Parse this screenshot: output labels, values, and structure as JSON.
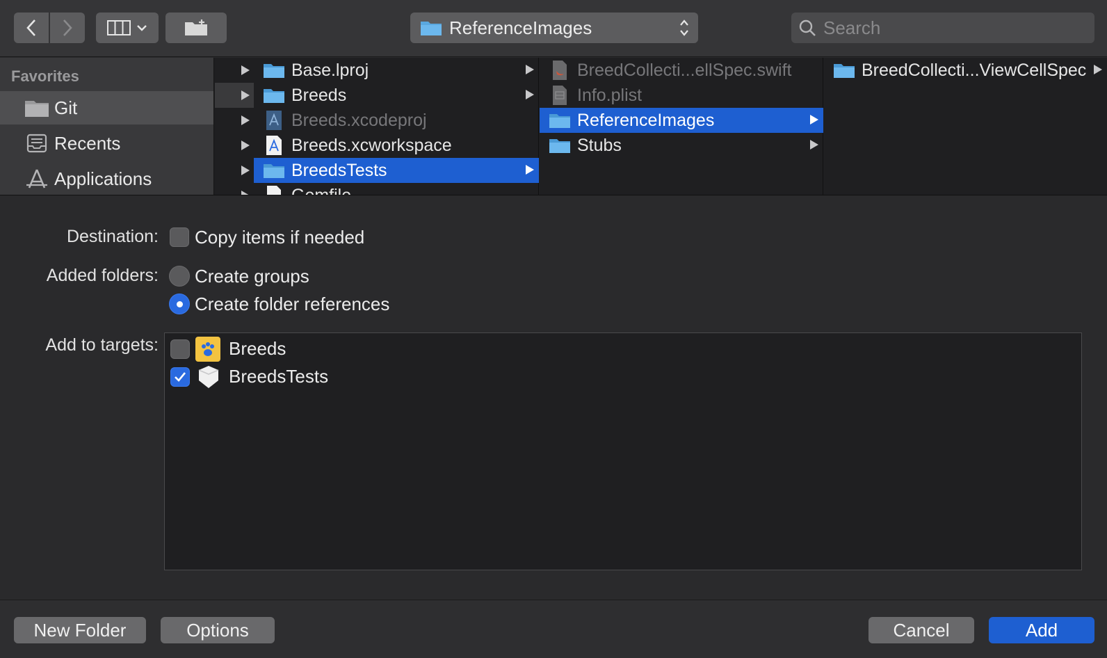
{
  "toolbar": {
    "path_popup_label": "ReferenceImages",
    "search_placeholder": "Search"
  },
  "sidebar": {
    "header": "Favorites",
    "items": [
      {
        "label": "Git",
        "icon": "folder-icon",
        "selected": true
      },
      {
        "label": "Recents",
        "icon": "recents-icon"
      },
      {
        "label": "Applications",
        "icon": "applications-icon"
      }
    ]
  },
  "columns": {
    "col1": [
      {
        "label": "Base.lproj",
        "icon": "folder-icon"
      },
      {
        "label": "Breeds",
        "icon": "folder-icon"
      },
      {
        "label": "Breeds.xcodeproj",
        "icon": "xcodeproj-icon",
        "dimmed": true
      },
      {
        "label": "Breeds.xcworkspace",
        "icon": "xcworkspace-icon"
      },
      {
        "label": "BreedsTests",
        "icon": "folder-icon",
        "selected": true
      },
      {
        "label": "Gemfile",
        "icon": "file-icon"
      }
    ],
    "col2": [
      {
        "label": "BreedCollecti...ellSpec.swift",
        "icon": "swift-file-icon",
        "dimmed": true
      },
      {
        "label": "Info.plist",
        "icon": "plist-file-icon",
        "dimmed": true
      },
      {
        "label": "ReferenceImages",
        "icon": "folder-icon",
        "selected": true
      },
      {
        "label": "Stubs",
        "icon": "folder-icon"
      }
    ],
    "col3": [
      {
        "label": "BreedCollecti...ViewCellSpec",
        "icon": "folder-icon"
      }
    ]
  },
  "options": {
    "destination_label": "Destination:",
    "copy_items_label": "Copy items if needed",
    "copy_items_checked": false,
    "added_folders_label": "Added folders:",
    "create_groups_label": "Create groups",
    "create_folder_refs_label": "Create folder references",
    "selected_folder_option": "Create folder references",
    "add_to_targets_label": "Add to targets:",
    "targets": [
      {
        "label": "Breeds",
        "checked": false,
        "icon": "paw-app-icon"
      },
      {
        "label": "BreedsTests",
        "checked": true,
        "icon": "test-bundle-icon"
      }
    ]
  },
  "footer": {
    "new_folder_label": "New Folder",
    "options_label": "Options",
    "cancel_label": "Cancel",
    "add_label": "Add"
  },
  "colors": {
    "accent": "#1e5fd1",
    "background": "#2a2a2c"
  }
}
